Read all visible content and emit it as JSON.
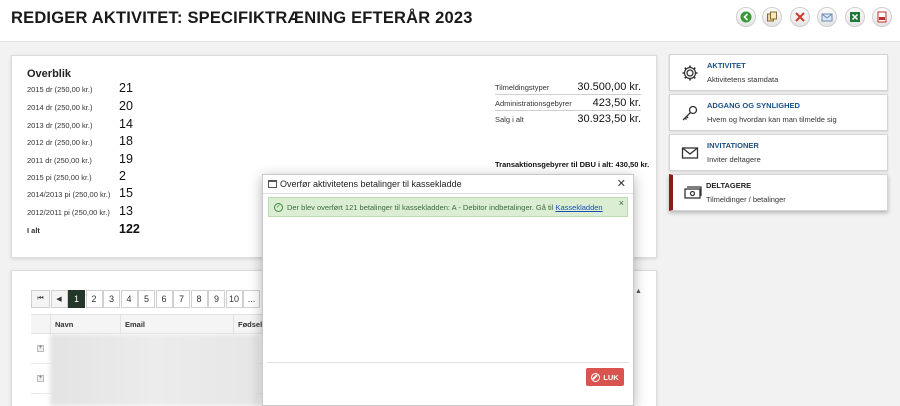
{
  "header": {
    "title": "REDIGER AKTIVITET: SPECIFIKTRÆNING EFTERÅR 2023",
    "toolbar": [
      {
        "icon": "back-arrow-icon",
        "color": "#3a9a3a"
      },
      {
        "icon": "copy-icon",
        "color": "#8a6a2a"
      },
      {
        "icon": "delete-x-icon",
        "color": "#d03a2a"
      },
      {
        "icon": "email-icon",
        "color": "#6a8ab8"
      },
      {
        "icon": "excel-icon",
        "color": "#1f7a3a"
      },
      {
        "icon": "pdf-icon",
        "color": "#c0302a"
      }
    ]
  },
  "overview": {
    "title": "Overblik",
    "rows": [
      {
        "label": "2015 dr (250,00 kr.)",
        "value": "21"
      },
      {
        "label": "2014 dr (250,00 kr.)",
        "value": "20"
      },
      {
        "label": "2013 dr (250,00 kr.)",
        "value": "14"
      },
      {
        "label": "2012 dr (250,00 kr.)",
        "value": "18"
      },
      {
        "label": "2011 dr (250,00 kr.)",
        "value": "19"
      },
      {
        "label": "2015 pi (250,00 kr.)",
        "value": "2"
      },
      {
        "label": "2014/2013 pi (250,00 kr.)",
        "value": "15"
      },
      {
        "label": "2012/2011 pi (250,00 kr.)",
        "value": "13"
      }
    ],
    "total": {
      "label": "I alt",
      "value": "122"
    }
  },
  "financial": {
    "rows": [
      {
        "label": "Tilmeldingstyper",
        "value": "30.500,00 kr."
      },
      {
        "label": "Administrationsgebyrer",
        "value": "423,50 kr."
      },
      {
        "label": "Salg i alt",
        "value": "30.923,50 kr."
      }
    ],
    "fee_note": "Transaktionsgebyrer til DBU i alt: 430,50 kr."
  },
  "sidebar": [
    {
      "title": "AKTIVITET",
      "subtitle": "Aktivitetens stamdata",
      "icon": "gear-icon"
    },
    {
      "title": "ADGANG OG SYNLIGHED",
      "subtitle": "Hvem og hvordan kan man tilmelde sig",
      "icon": "key-icon"
    },
    {
      "title": "INVITATIONER",
      "subtitle": "Inviter deltagere",
      "icon": "envelope-icon"
    },
    {
      "title": "DELTAGERE",
      "subtitle": "Tilmeldinger / betalinger",
      "icon": "money-icon",
      "active": true
    }
  ],
  "pager": {
    "first": "⏮",
    "prev": "◀",
    "pages": [
      "1",
      "2",
      "3",
      "4",
      "5",
      "6",
      "7",
      "8",
      "9",
      "10",
      "..."
    ],
    "current": "1"
  },
  "grid": {
    "columns": [
      "Navn",
      "Email",
      "Fødsel"
    ],
    "expand_label": "+"
  },
  "modal": {
    "title": "Overfør aktivitetens betalinger til kassekladde",
    "close_glyph": "✕",
    "alert_text": "Der blev overført 121 betalinger til kassekladden: A - Debitor indbetalinger. Gå til ",
    "alert_link": "Kassekladden",
    "alert_close": "×",
    "close_button": "LUK"
  },
  "colors": {
    "accent_active": "#8b1a1a",
    "link": "#1c4f85",
    "pager_current": "#23362a",
    "close_button": "#d9534f",
    "alert_bg": "#dbeed4"
  }
}
